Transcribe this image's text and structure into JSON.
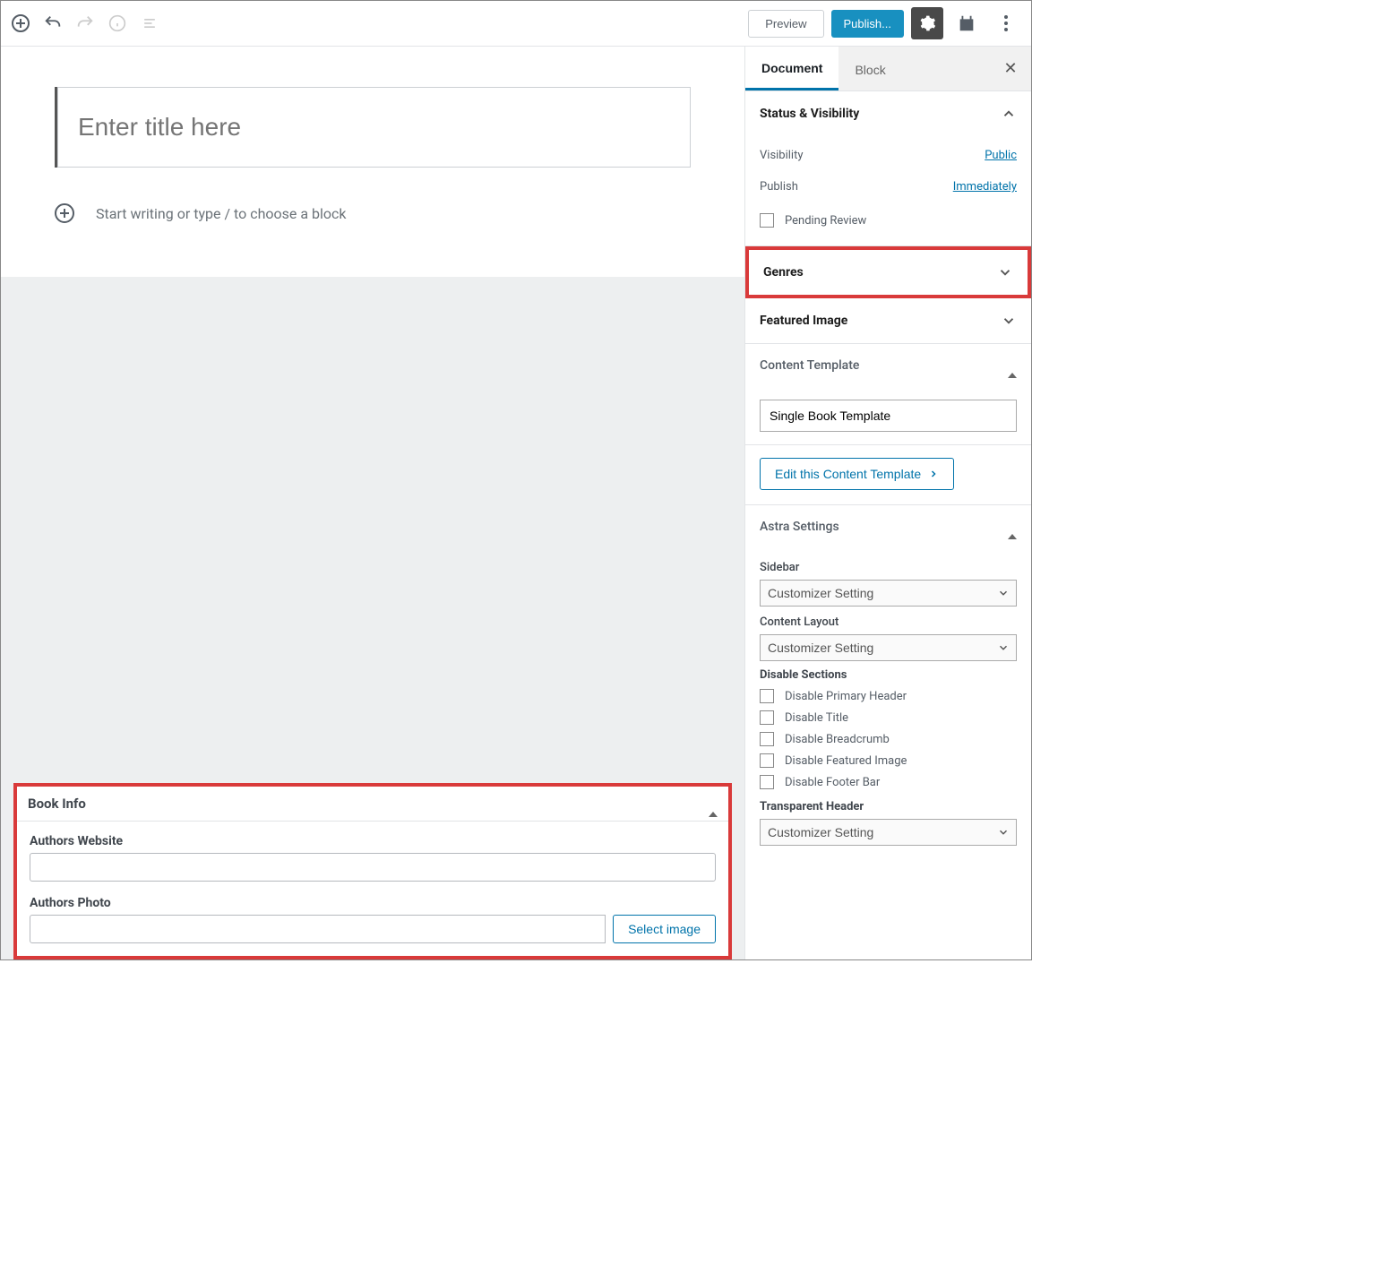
{
  "toolbar": {
    "preview_label": "Preview",
    "publish_label": "Publish..."
  },
  "editor": {
    "title_placeholder": "Enter title here",
    "block_placeholder": "Start writing or type / to choose a block"
  },
  "book_info": {
    "panel_title": "Book Info",
    "authors_website_label": "Authors Website",
    "authors_website_value": "",
    "authors_photo_label": "Authors Photo",
    "authors_photo_value": "",
    "select_image_label": "Select image"
  },
  "sidebar": {
    "tabs": {
      "document": "Document",
      "block": "Block"
    },
    "status": {
      "title": "Status & Visibility",
      "visibility_label": "Visibility",
      "visibility_value": "Public",
      "publish_label": "Publish",
      "publish_value": "Immediately",
      "pending_review_label": "Pending Review"
    },
    "genres": {
      "title": "Genres"
    },
    "featured_image": {
      "title": "Featured Image"
    },
    "content_template": {
      "title": "Content Template",
      "value": "Single Book Template",
      "edit_label": "Edit this Content Template"
    },
    "astra": {
      "title": "Astra Settings",
      "sidebar_label": "Sidebar",
      "sidebar_value": "Customizer Setting",
      "content_layout_label": "Content Layout",
      "content_layout_value": "Customizer Setting",
      "disable_sections_label": "Disable Sections",
      "disable_options": [
        "Disable Primary Header",
        "Disable Title",
        "Disable Breadcrumb",
        "Disable Featured Image",
        "Disable Footer Bar"
      ],
      "transparent_header_label": "Transparent Header",
      "transparent_header_value": "Customizer Setting"
    }
  }
}
